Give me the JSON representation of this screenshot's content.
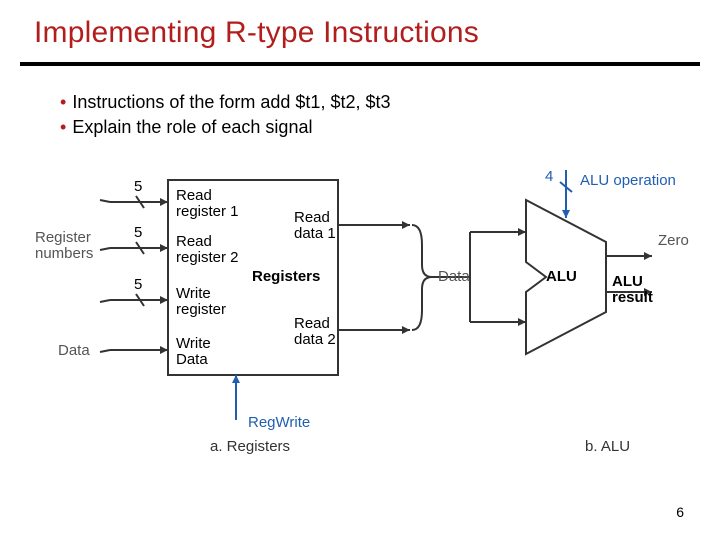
{
  "title": "Implementing R-type Instructions",
  "bullets": [
    "Instructions of the form  add  $t1, $t2, $t3",
    "Explain the role of each signal"
  ],
  "labels": {
    "register_numbers": "Register\nnumbers",
    "data_left": "Data",
    "bus5a": "5",
    "bus5b": "5",
    "bus5c": "5",
    "rr1": "Read\nregister 1",
    "rr2": "Read\nregister 2",
    "wr": "Write\nregister",
    "wd": "Write\nData",
    "registers_title": "Registers",
    "regwrite": "RegWrite",
    "rd1": "Read\ndata 1",
    "rd2": "Read\ndata 2",
    "data_mid": "Data",
    "alu_op_bits": "4",
    "alu_operation": "ALU operation",
    "zero": "Zero",
    "alu": "ALU",
    "alu_result": "ALU\nresult",
    "caption_a": "a. Registers",
    "caption_b": "b. ALU"
  },
  "page_number": "6"
}
